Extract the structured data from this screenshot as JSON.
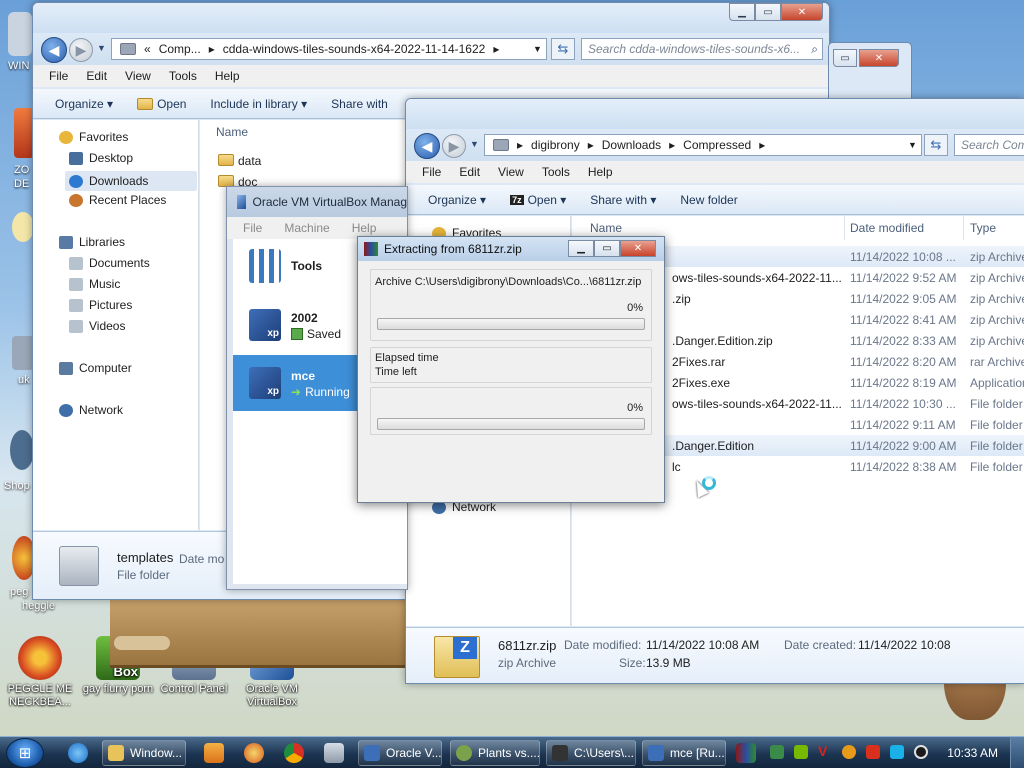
{
  "desktop": {
    "icons": [
      {
        "label": "PEGGLE ME NECKBEA...",
        "color": "#d94c22"
      },
      {
        "label": "gay flurry porn",
        "color": "#4a8f2e"
      },
      {
        "label": "Control Panel",
        "color": "#6f86a6"
      },
      {
        "label": "Oracle VM VirtualBox",
        "color": "#2e5ea8"
      }
    ],
    "box_label": "Box",
    "edge_labels": [
      "WIN",
      "ZO",
      "DE",
      "uk",
      "Shop",
      "peg",
      "heggle"
    ]
  },
  "explorer_back": {
    "breadcrumb": [
      "«",
      "Comp...",
      "cdda-windows-tiles-sounds-x64-2022-11-14-1622"
    ],
    "search_placeholder": "Search cdda-windows-tiles-sounds-x6...",
    "menu": [
      "File",
      "Edit",
      "View",
      "Tools",
      "Help"
    ],
    "commands": [
      "Organize ▾",
      "Open",
      "Include in library ▾",
      "Share with"
    ],
    "nav": {
      "favorites": "Favorites",
      "fav_items": [
        "Desktop",
        "Downloads",
        "Recent Places"
      ],
      "libraries": "Libraries",
      "lib_items": [
        "Documents",
        "Music",
        "Pictures",
        "Videos"
      ],
      "computer": "Computer",
      "network": "Network"
    },
    "column_name": "Name",
    "files": [
      "data",
      "doc"
    ],
    "details": {
      "name": "templates",
      "type": "File folder",
      "extra": "Date mo"
    }
  },
  "virtualbox": {
    "title": "Oracle VM VirtualBox Manag",
    "menu": [
      "File",
      "Machine",
      "Help"
    ],
    "tools_label": "Tools",
    "vms": [
      {
        "name": "2002",
        "state": "Saved",
        "badge": "xp"
      },
      {
        "name": "mce",
        "state": "Running",
        "badge": "xp"
      }
    ]
  },
  "extract_dialog": {
    "title": "Extracting from 6811zr.zip",
    "archive_line": "Archive C:\\Users\\digibrony\\Downloads\\Co...\\6811zr.zip",
    "progress_top": "0%",
    "progress_top_value": 0,
    "elapsed_label": "Elapsed time",
    "left_label": "Time left",
    "progress_bottom": "0%",
    "progress_bottom_value": 0
  },
  "explorer_front": {
    "breadcrumb": [
      "digibrony",
      "Downloads",
      "Compressed"
    ],
    "search_placeholder": "Search Com",
    "menu": [
      "File",
      "Edit",
      "View",
      "Tools",
      "Help"
    ],
    "commands": [
      "Organize ▾",
      "Open ▾",
      "Share with ▾",
      "New folder"
    ],
    "open_badge": "7z",
    "nav": {
      "favorites": "Favorites",
      "network": "Network"
    },
    "columns": {
      "name": "Name",
      "date": "Date modified",
      "type": "Type"
    },
    "rows": [
      {
        "name": "",
        "date": "11/14/2022 10:08 ...",
        "type": "zip Archive",
        "selected": true
      },
      {
        "name": "ows-tiles-sounds-x64-2022-11...",
        "date": "11/14/2022 9:52 AM",
        "type": "zip Archive",
        "selected": false
      },
      {
        "name": ".zip",
        "date": "11/14/2022 9:05 AM",
        "type": "zip Archive",
        "selected": false
      },
      {
        "name": "",
        "date": "11/14/2022 8:41 AM",
        "type": "zip Archive",
        "selected": false
      },
      {
        "name": ".Danger.Edition.zip",
        "date": "11/14/2022 8:33 AM",
        "type": "zip Archive",
        "selected": false
      },
      {
        "name": "2Fixes.rar",
        "date": "11/14/2022 8:20 AM",
        "type": "rar Archive",
        "selected": false
      },
      {
        "name": "2Fixes.exe",
        "date": "11/14/2022 8:19 AM",
        "type": "Application",
        "selected": false
      },
      {
        "name": "ows-tiles-sounds-x64-2022-11...",
        "date": "11/14/2022 10:30 ...",
        "type": "File folder",
        "selected": false
      },
      {
        "name": "",
        "date": "11/14/2022 9:11 AM",
        "type": "File folder",
        "selected": false
      },
      {
        "name": ".Danger.Edition",
        "date": "11/14/2022 9:00 AM",
        "type": "File folder",
        "selected": true
      },
      {
        "name": "lc",
        "date": "11/14/2022 8:38 AM",
        "type": "File folder",
        "selected": false
      }
    ],
    "details": {
      "name": "6811zr.zip",
      "type": "zip Archive",
      "icon_letter": "Z",
      "modified_label": "Date modified:",
      "modified_value": "11/14/2022 10:08 AM",
      "size_label": "Size:",
      "size_value": "13.9 MB",
      "created_label": "Date created:",
      "created_value": "11/14/2022 10:08"
    }
  },
  "taskbar": {
    "start_glyph": "⊞",
    "items": [
      {
        "label": "Window...",
        "color": "#e8c35a"
      },
      {
        "label": "Oracle V...",
        "color": "#3c6fb8"
      },
      {
        "label": "Plants vs....",
        "color": "#7aa24a"
      },
      {
        "label": "C:\\Users\\...",
        "color": "#333333"
      },
      {
        "label": "mce [Ru...",
        "color": "#3c6fb8"
      }
    ],
    "clock": "10:33 AM"
  }
}
